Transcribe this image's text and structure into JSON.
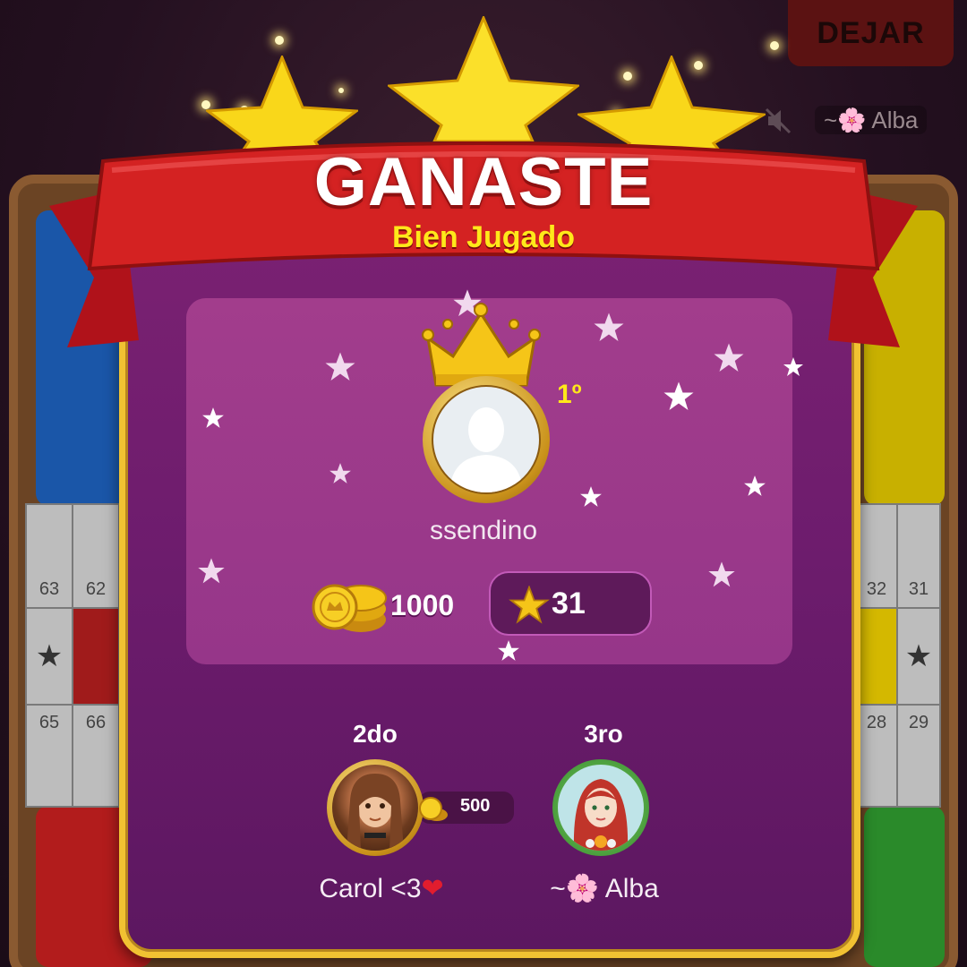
{
  "game": {
    "leave_button": "DEJAR",
    "top_player_name": "~🌸 Alba"
  },
  "result": {
    "title": "GANASTE",
    "subtitle": "Bien Jugado",
    "stars_earned": 3
  },
  "winner": {
    "rank": "1º",
    "name": "ssendino",
    "coins": "1000",
    "stars": "31"
  },
  "runners_up": [
    {
      "rank": "2do",
      "name": "Carol <3",
      "name_suffix": "❤",
      "prize": "500"
    },
    {
      "rank": "3ro",
      "name": "~🌸 Alba"
    }
  ],
  "board": {
    "left_cells_top": [
      "63",
      "62"
    ],
    "left_cells_bottom": [
      "65",
      "66"
    ],
    "right_cells_top": [
      "32",
      "31"
    ],
    "right_cells_bottom": [
      "28",
      "29"
    ]
  },
  "colors": {
    "dialog_purple": "#6d1c6d",
    "ribbon_red": "#d42222",
    "gold": "#f1c232",
    "accent_yellow": "#ffe81a"
  }
}
